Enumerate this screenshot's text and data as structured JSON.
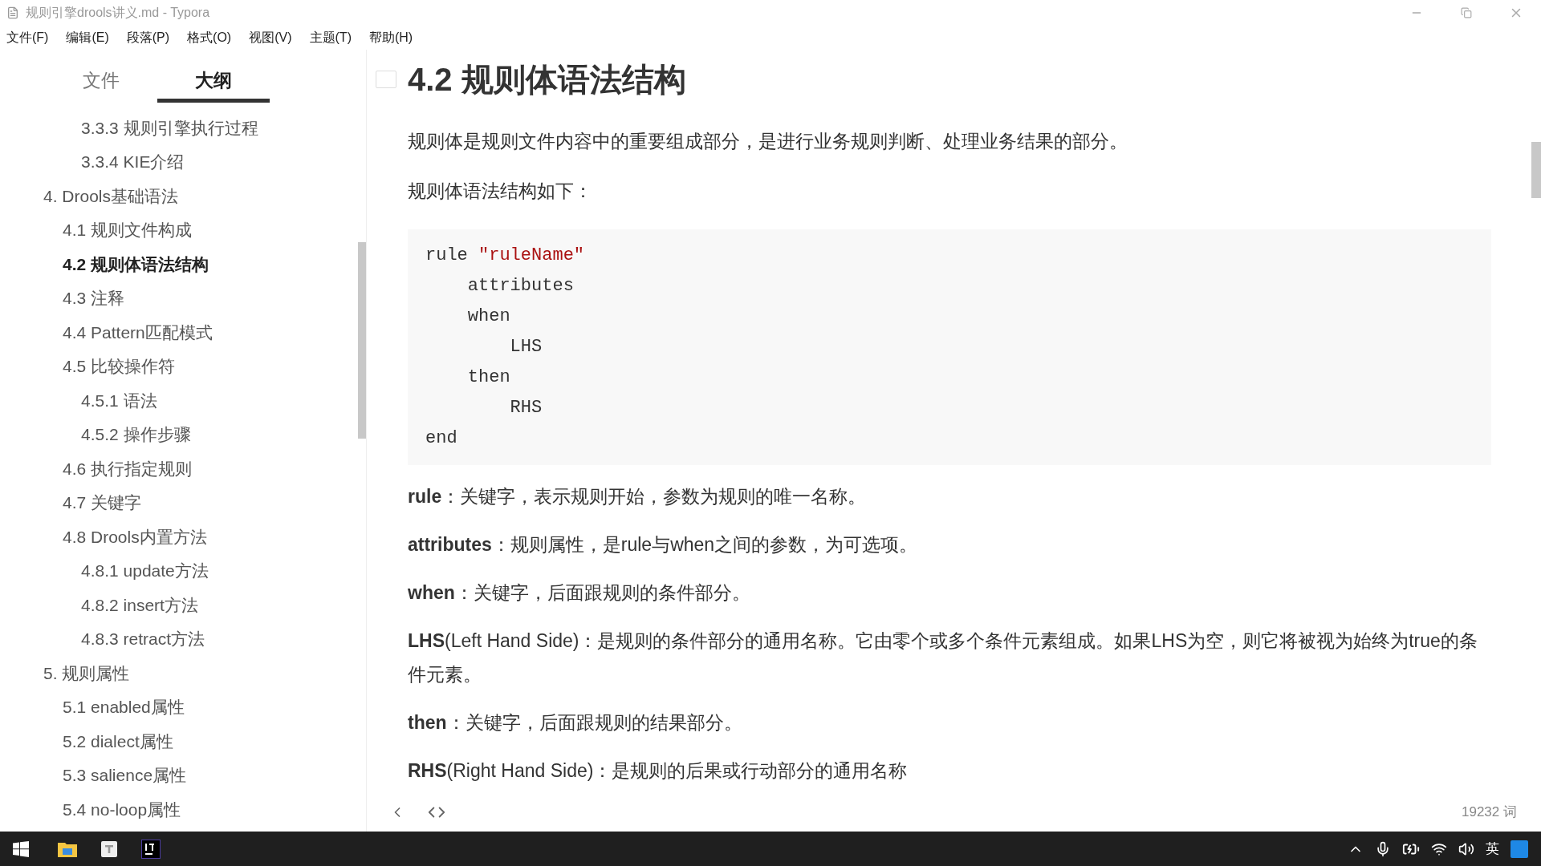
{
  "window": {
    "title": "规则引擎drools讲义.md - Typora"
  },
  "menu": [
    "文件(F)",
    "编辑(E)",
    "段落(P)",
    "格式(O)",
    "视图(V)",
    "主题(T)",
    "帮助(H)"
  ],
  "sidebar": {
    "tabs": [
      {
        "label": "文件",
        "selected": false
      },
      {
        "label": "大纲",
        "selected": true
      }
    ],
    "outline": [
      {
        "children": [
          {
            "children": [
              {
                "label": "3.3.3 规则引擎执行过程",
                "selected": false
              },
              {
                "label": "3.3.4 KIE介绍",
                "selected": false
              }
            ]
          }
        ]
      },
      {
        "label": "4. Drools基础语法",
        "selected": false,
        "children": [
          {
            "label": "4.1 规则文件构成",
            "selected": false
          },
          {
            "label": "4.2 规则体语法结构",
            "selected": true
          },
          {
            "label": "4.3 注释",
            "selected": false
          },
          {
            "label": "4.4 Pattern匹配模式",
            "selected": false
          },
          {
            "label": "4.5 比较操作符",
            "selected": false,
            "children": [
              {
                "label": "4.5.1 语法",
                "selected": false
              },
              {
                "label": "4.5.2 操作步骤",
                "selected": false
              }
            ]
          },
          {
            "label": "4.6 执行指定规则",
            "selected": false
          },
          {
            "label": "4.7 关键字",
            "selected": false
          },
          {
            "label": "4.8 Drools内置方法",
            "selected": false,
            "children": [
              {
                "label": "4.8.1 update方法",
                "selected": false
              },
              {
                "label": "4.8.2 insert方法",
                "selected": false
              },
              {
                "label": "4.8.3 retract方法",
                "selected": false
              }
            ]
          }
        ]
      },
      {
        "label": "5. 规则属性",
        "selected": false,
        "children": [
          {
            "label": "5.1 enabled属性",
            "selected": false
          },
          {
            "label": "5.2 dialect属性",
            "selected": false
          },
          {
            "label": "5.3 salience属性",
            "selected": false
          },
          {
            "label": "5.4 no-loop属性",
            "selected": false
          }
        ]
      }
    ]
  },
  "document": {
    "heading": "4.2 规则体语法结构",
    "intro": [
      "规则体是规则文件内容中的重要组成部分，是进行业务规则判断、处理业务结果的部分。",
      "规则体语法结构如下："
    ],
    "code": [
      [
        {
          "kind": "plain",
          "text": "rule "
        },
        {
          "kind": "string",
          "text": "\"ruleName\""
        }
      ],
      [
        {
          "kind": "plain",
          "text": "    attributes"
        }
      ],
      [
        {
          "kind": "plain",
          "text": "    when"
        }
      ],
      [
        {
          "kind": "plain",
          "text": "        LHS"
        }
      ],
      [
        {
          "kind": "plain",
          "text": "    then"
        }
      ],
      [
        {
          "kind": "plain",
          "text": "        RHS"
        }
      ],
      [
        {
          "kind": "plain",
          "text": "end"
        }
      ]
    ],
    "definitions": [
      "**rule**：关键字，表示规则开始，参数为规则的唯一名称。",
      "**attributes**：规则属性，是rule与when之间的参数，为可选项。",
      "**when**：关键字，后面跟规则的条件部分。",
      "**LHS**(Left Hand Side)：是规则的条件部分的通用名称。它由零个或多个条件元素组成。如果LHS为空，则它将被视为始终为true的条件元素。",
      "**then**：关键字，后面跟规则的结果部分。",
      "**RHS**(Right Hand Side)：是规则的后果或行动部分的通用名称"
    ]
  },
  "status_bar": {
    "word_count": "19232 词"
  },
  "taskbar": {
    "input_method": "英"
  }
}
